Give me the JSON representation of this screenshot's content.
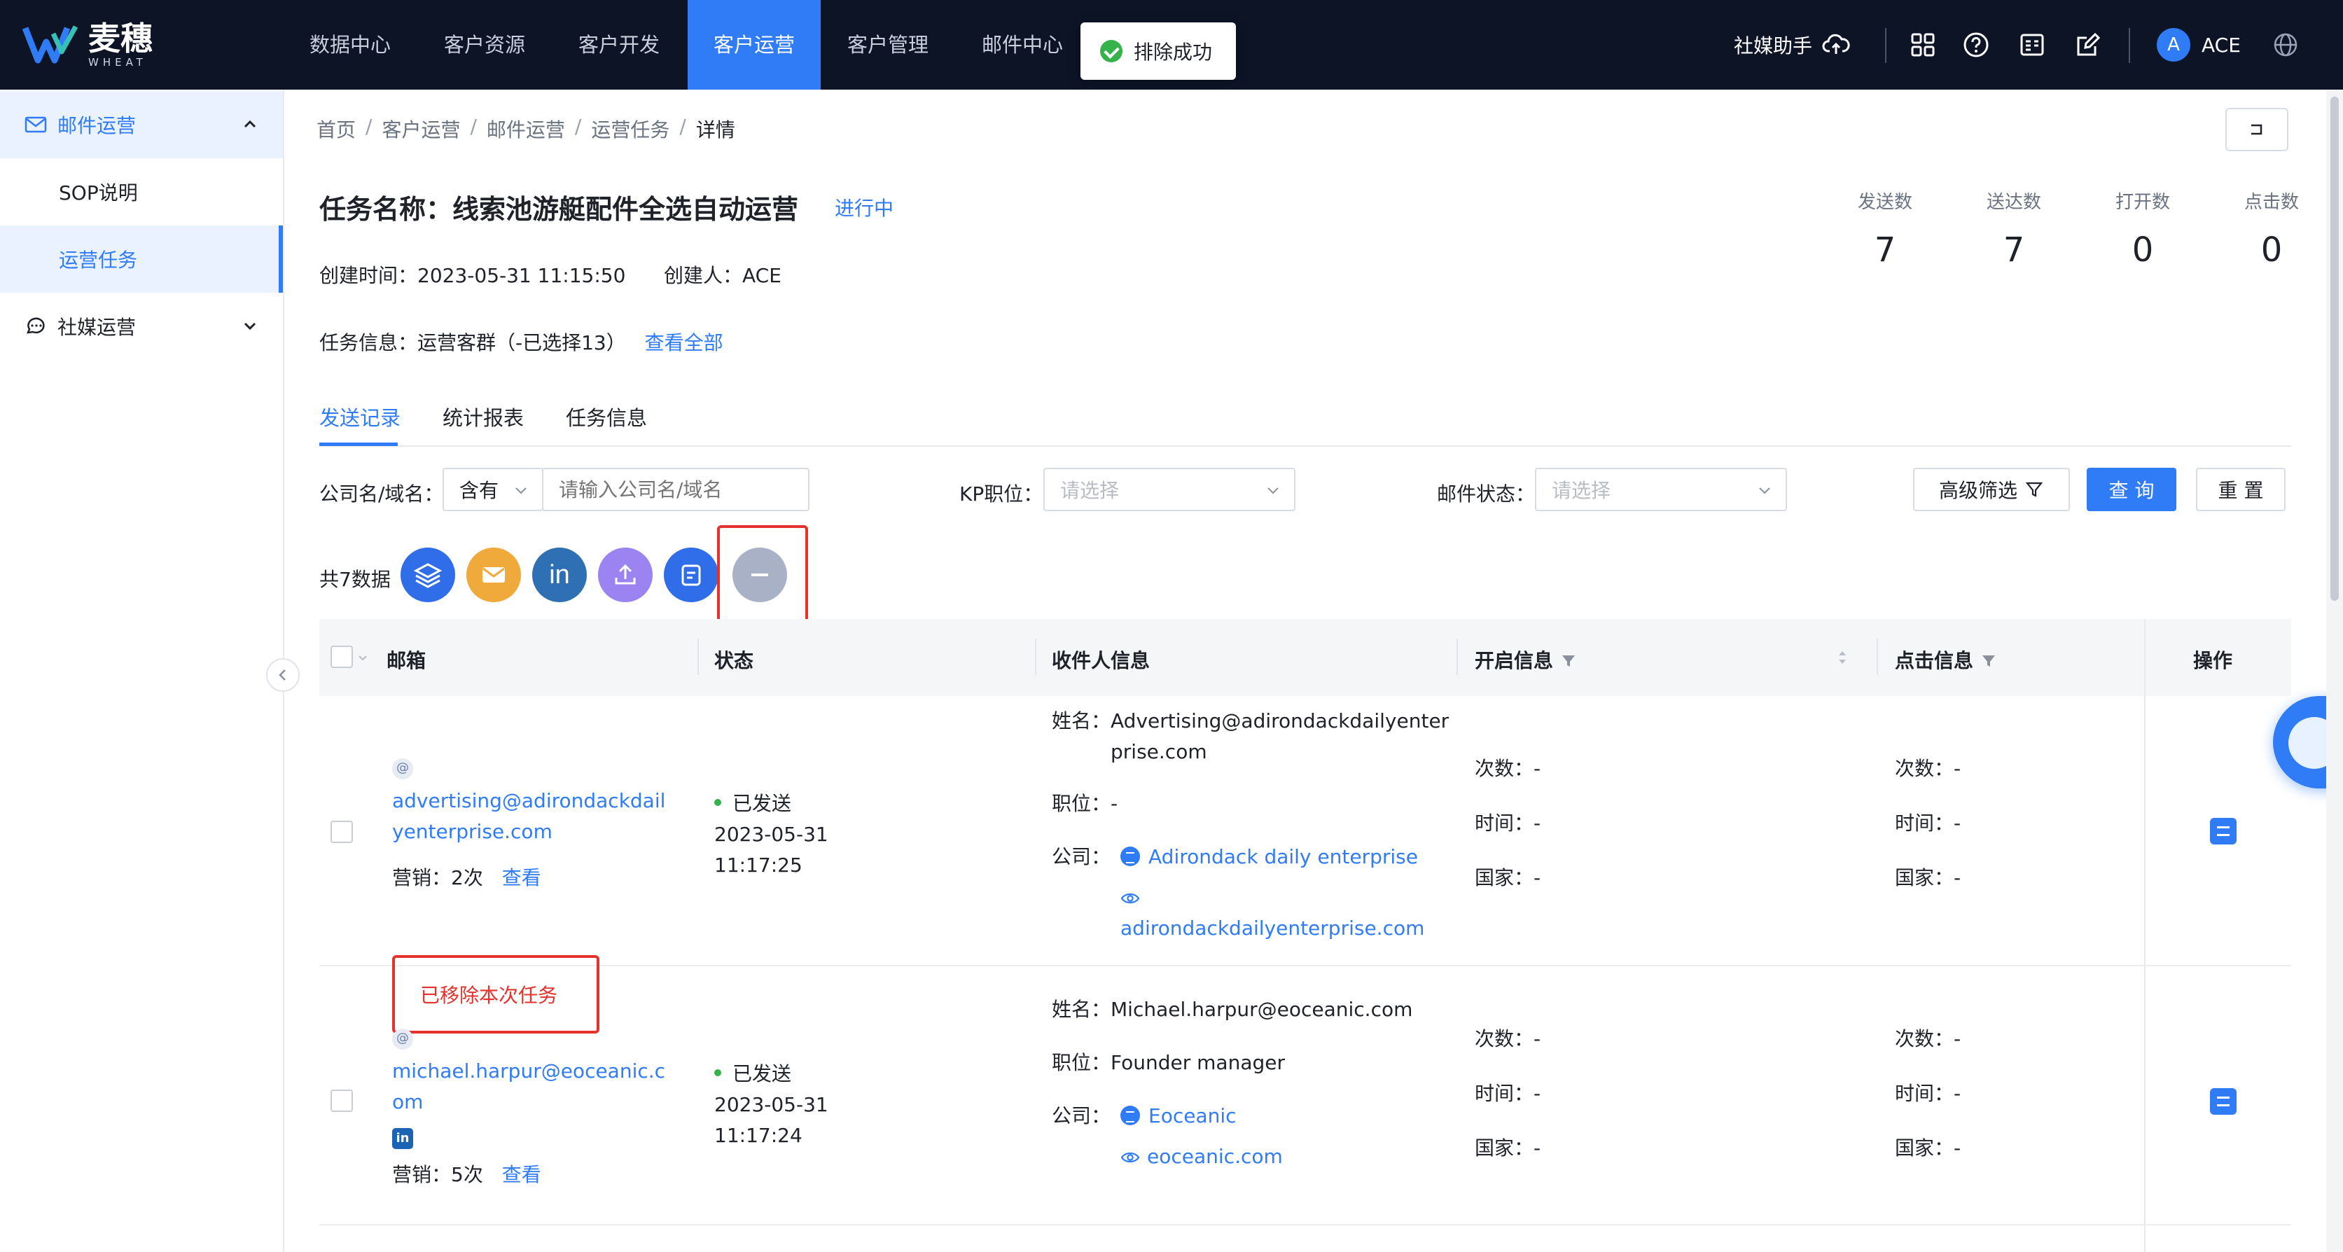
{
  "app": {
    "brand": "麦穗",
    "brand_sub": "WHEAT",
    "brand_color": "#2f7cf6"
  },
  "nav": {
    "items": [
      {
        "label": "数据中心"
      },
      {
        "label": "客户资源"
      },
      {
        "label": "客户开发"
      },
      {
        "label": "客户运营",
        "active": true
      },
      {
        "label": "客户管理"
      },
      {
        "label": "邮件中心"
      }
    ]
  },
  "toast": {
    "text": "排除成功",
    "icon": "check-circle-icon"
  },
  "topbar": {
    "assistant": "社媒助手",
    "user_initial": "A",
    "user_name": "ACE",
    "icons": [
      "cloud-upload-icon",
      "apps-grid-icon",
      "help-circle-icon",
      "id-card-icon",
      "edit-icon",
      "globe-icon"
    ]
  },
  "sidebar": {
    "groups": [
      {
        "label": "邮件运营",
        "icon": "mail-icon",
        "expanded": true,
        "items": [
          {
            "label": "SOP说明"
          },
          {
            "label": "运营任务",
            "active": true
          }
        ]
      },
      {
        "label": "社媒运营",
        "icon": "chat-icon",
        "expanded": false
      }
    ]
  },
  "breadcrumb": [
    "首页",
    "客户运营",
    "邮件运营",
    "运营任务",
    "详情"
  ],
  "task": {
    "title": "任务名称：线索池游艇配件全选自动运营",
    "status": "进行中",
    "created_at_label": "创建时间：",
    "created_at": "2023-05-31 11:15:50",
    "creator_label": "创建人：",
    "creator": "ACE",
    "info_label": "任务信息：",
    "info": "运营客群（-已选择13）",
    "info_link": "查看全部"
  },
  "stats": [
    {
      "label": "发送数",
      "value": "7"
    },
    {
      "label": "送达数",
      "value": "7"
    },
    {
      "label": "打开数",
      "value": "0"
    },
    {
      "label": "点击数",
      "value": "0"
    }
  ],
  "tabs": [
    {
      "label": "发送记录",
      "active": true
    },
    {
      "label": "统计报表"
    },
    {
      "label": "任务信息"
    }
  ],
  "filters": {
    "company_label": "公司名/域名：",
    "company_mode": "含有",
    "company_placeholder": "请输入公司名/域名",
    "kp_label": "KP职位：",
    "kp_placeholder": "请选择",
    "mail_status_label": "邮件状态：",
    "mail_status_placeholder": "请选择",
    "advanced": "高级筛选",
    "query": "查 询",
    "reset": "重 置"
  },
  "toolbar": {
    "count": "共7数据",
    "actions": [
      {
        "icon": "layers-icon",
        "color": "#2f6ee8"
      },
      {
        "icon": "envelope-icon",
        "color": "#f0a93b"
      },
      {
        "icon": "linkedin-icon",
        "color": "#2f6fb3"
      },
      {
        "icon": "upload-icon",
        "color": "#9b83f2"
      },
      {
        "icon": "document-icon",
        "color": "#2f6ee8"
      },
      {
        "icon": "minus-circle-icon",
        "color": "#a9b1c7"
      }
    ]
  },
  "table": {
    "columns": {
      "email": "邮箱",
      "status": "状态",
      "recipient": "收件人信息",
      "open": "开启信息",
      "click": "点击信息",
      "op": "操作"
    },
    "labels": {
      "name": "姓名：",
      "position": "职位：",
      "company": "公司：",
      "times": "次数：",
      "time": "时间：",
      "country": "国家：",
      "marketing": "营销：",
      "view": "查看"
    },
    "rows": [
      {
        "email": "advertising@adirondackdailyenterprise.com",
        "email_line1": "advertising@adirondackdail",
        "email_line2": "yenterprise.com",
        "marketing": "2次",
        "removed": "已移除本次任务",
        "status": "已发送",
        "date": "2023-05-31",
        "time": "11:17:25",
        "name_line1": "Advertising@adirondackdailyenter",
        "name_line2": "prise.com",
        "position": "-",
        "company": "Adirondack daily enterprise",
        "domain": "adirondackdailyenterprise.com",
        "open_times": "-",
        "open_time": "-",
        "open_country": "-",
        "click_times": "-",
        "click_time": "-",
        "click_country": "-"
      },
      {
        "email_line1": "michael.harpur@eoceanic.c",
        "email_line2": "om",
        "marketing": "5次",
        "status": "已发送",
        "date": "2023-05-31",
        "time": "11:17:24",
        "name": "Michael.harpur@eoceanic.com",
        "position": "Founder manager",
        "company": "Eoceanic",
        "domain": "eoceanic.com",
        "open_times": "-",
        "open_time": "-",
        "open_country": "-",
        "click_times": "-",
        "click_time": "-",
        "click_country": "-"
      }
    ]
  }
}
